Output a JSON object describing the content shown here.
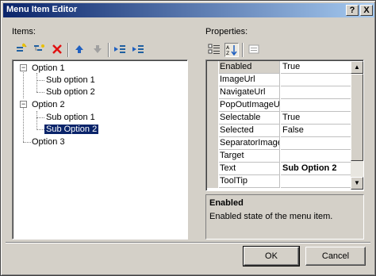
{
  "window": {
    "title": "Menu Item Editor",
    "help_glyph": "?",
    "close_glyph": "X"
  },
  "items_panel": {
    "label": "Items:",
    "toolbar": [
      "add-root-item-icon",
      "add-child-item-icon",
      "delete-item-icon",
      "move-up-icon",
      "move-down-icon",
      "outdent-icon",
      "indent-icon"
    ],
    "tree": [
      {
        "label": "Option 1",
        "expander": "−"
      },
      {
        "label": "Sub option 1"
      },
      {
        "label": "Sub option 2"
      },
      {
        "label": "Option 2",
        "expander": "−"
      },
      {
        "label": "Sub option 1"
      },
      {
        "label": "Sub Option 2",
        "selected": true
      },
      {
        "label": "Option 3"
      }
    ]
  },
  "properties_panel": {
    "label": "Properties:",
    "toolbar": [
      "categorized-icon",
      "alphabetical-icon",
      "property-pages-icon"
    ],
    "rows": [
      {
        "name": "Enabled",
        "value": "True",
        "selected": true
      },
      {
        "name": "ImageUrl",
        "value": ""
      },
      {
        "name": "NavigateUrl",
        "value": ""
      },
      {
        "name": "PopOutImageUr",
        "value": ""
      },
      {
        "name": "Selectable",
        "value": "True"
      },
      {
        "name": "Selected",
        "value": "False"
      },
      {
        "name": "SeparatorImage",
        "value": ""
      },
      {
        "name": "Target",
        "value": ""
      },
      {
        "name": "Text",
        "value": "Sub Option 2",
        "bold": true
      },
      {
        "name": "ToolTip",
        "value": ""
      }
    ],
    "description": {
      "title": "Enabled",
      "text": "Enabled state of the menu item."
    }
  },
  "buttons": {
    "ok": "OK",
    "cancel": "Cancel"
  }
}
